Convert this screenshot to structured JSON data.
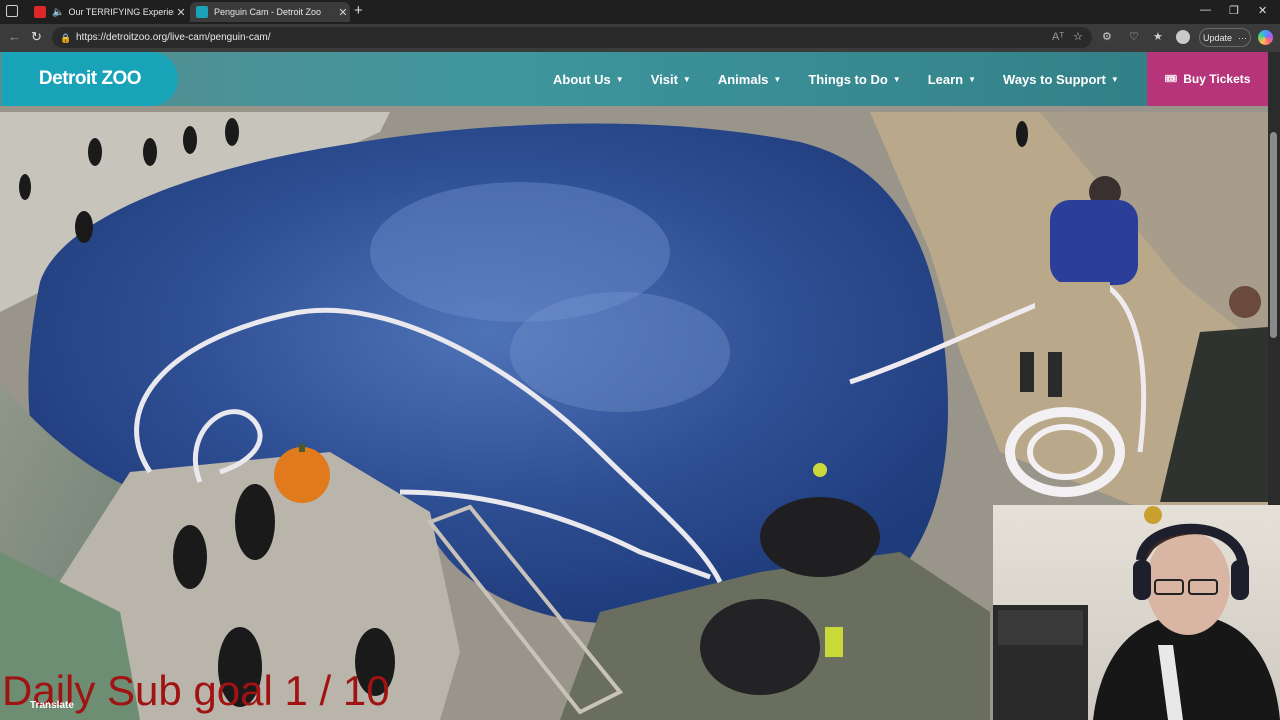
{
  "browser": {
    "tabs": [
      {
        "title": "Our TERRIFYING Experience",
        "favicon_color": "#e02727",
        "active": false
      },
      {
        "title": "Penguin Cam - Detroit Zoo",
        "favicon_color": "#19a3b8",
        "active": true
      }
    ],
    "url": "https://detroitzoo.org/live-cam/penguin-cam/",
    "update_label": "Update",
    "reader_icon": "Aᵀ"
  },
  "site": {
    "logo_text": "Detroit ZOO",
    "nav": [
      "About Us",
      "Visit",
      "Animals",
      "Things to Do",
      "Learn",
      "Ways to Support"
    ],
    "cta_label": "Buy Tickets",
    "brand_color": "#19a3b8",
    "cta_color": "#b6357a"
  },
  "overlay": {
    "sub_goal_text": "Daily Sub goal 1 / 10",
    "translate_label": "Translate"
  }
}
